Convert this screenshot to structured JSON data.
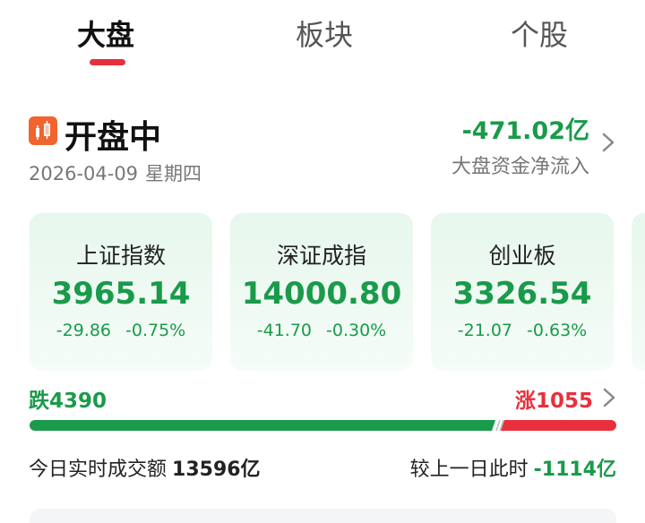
{
  "tabs": [
    {
      "label": "大盘",
      "active": true
    },
    {
      "label": "板块",
      "active": false
    },
    {
      "label": "个股",
      "active": false
    }
  ],
  "market": {
    "status": "开盘中",
    "date": "2026-04-09",
    "weekday": "星期四",
    "net_flow_value": "-471.02亿",
    "net_flow_label": "大盘资金净流入"
  },
  "indices": [
    {
      "name": "上证指数",
      "value": "3965.14",
      "change": "-29.86",
      "change_pct": "-0.75%"
    },
    {
      "name": "深证成指",
      "value": "14000.80",
      "change": "-41.70",
      "change_pct": "-0.30%"
    },
    {
      "name": "创业板",
      "value": "3326.54",
      "change": "-21.07",
      "change_pct": "-0.63%"
    }
  ],
  "breadth": {
    "fall_label": "跌4390",
    "rise_label": "涨1055",
    "fall": 4390,
    "rise": 1055
  },
  "turnover": {
    "label": "今日实时成交额",
    "value": "13596亿",
    "compare_label": "较上一日此时",
    "compare_value": "-1114亿"
  },
  "colors": {
    "down": "#1a9a4b",
    "up": "#e8303c",
    "accent": "#e8303c",
    "status_icon": "#f0642e"
  },
  "icons": {
    "status": "candlestick-icon",
    "more": "chevron-right-icon"
  }
}
